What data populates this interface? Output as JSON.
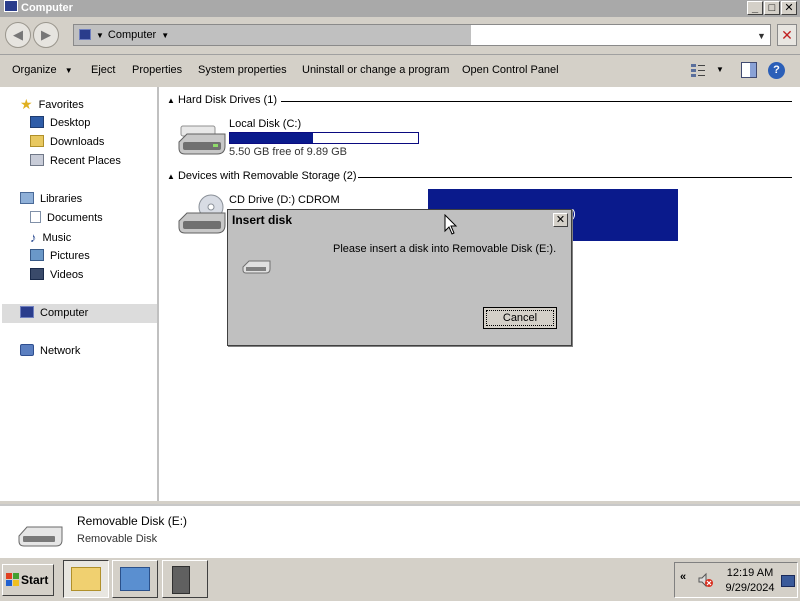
{
  "window": {
    "title": "Computer",
    "buttons": {
      "minimize": "_",
      "maximize": "□",
      "close": "✕"
    }
  },
  "address": {
    "location": "Computer",
    "icon": "computer-icon"
  },
  "toolbar": {
    "items": [
      "Organize",
      "Eject",
      "Properties",
      "System properties",
      "Uninstall or change a program",
      "Open Control Panel"
    ],
    "organize_arrow": "▼",
    "views_arrow": "▼",
    "help": "?"
  },
  "nav": {
    "favorites": "Favorites",
    "desktop": "Desktop",
    "downloads": "Downloads",
    "recent": "Recent Places",
    "libraries": "Libraries",
    "documents": "Documents",
    "music": "Music",
    "pictures": "Pictures",
    "videos": "Videos",
    "computer": "Computer",
    "network": "Network"
  },
  "content": {
    "hdd_group": "Hard Disk Drives (1)",
    "removable_group": "Devices with Removable Storage (2)",
    "local_disk": {
      "name": "Local Disk (C:)",
      "free": "5.50 GB free of 9.89 GB",
      "used_fraction": 0.444
    },
    "cd_drive": {
      "name": "CD Drive (D:) CDROM"
    },
    "removable_partial": ":)"
  },
  "dialog": {
    "title": "Insert disk",
    "message": "Please insert a disk into Removable Disk (E:).",
    "cancel": "Cancel",
    "close": "✕"
  },
  "details": {
    "name": "Removable Disk (E:)",
    "type": "Removable Disk"
  },
  "taskbar": {
    "start": "Start",
    "tray_expand": "«",
    "time": "12:19 AM",
    "date": "9/29/2024"
  },
  "colors": {
    "selection": "#0a1a8c",
    "titlebar": "#a9a9a9",
    "face": "#d4d0c8"
  }
}
